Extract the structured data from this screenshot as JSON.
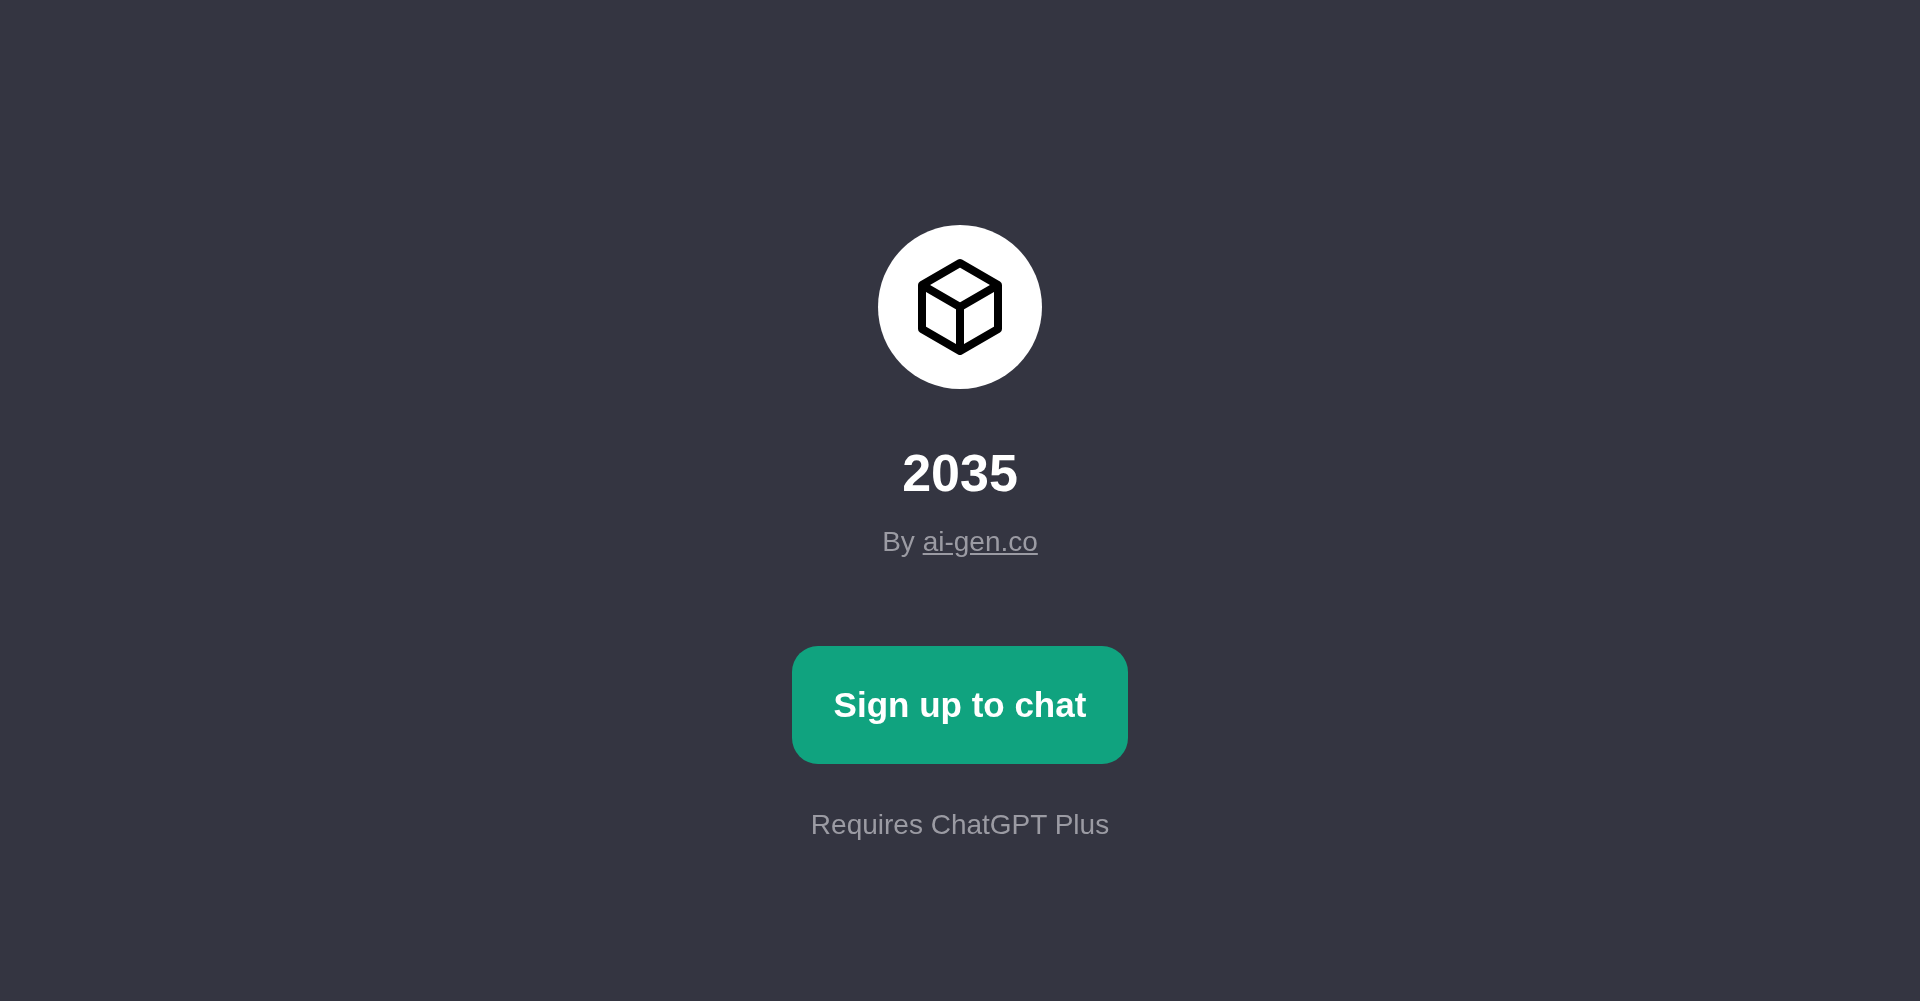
{
  "gpt": {
    "title": "2035",
    "author_prefix": "By",
    "author_link": "ai-gen.co"
  },
  "signup_button": {
    "label": "Sign up to chat"
  },
  "note": "Requires ChatGPT Plus"
}
